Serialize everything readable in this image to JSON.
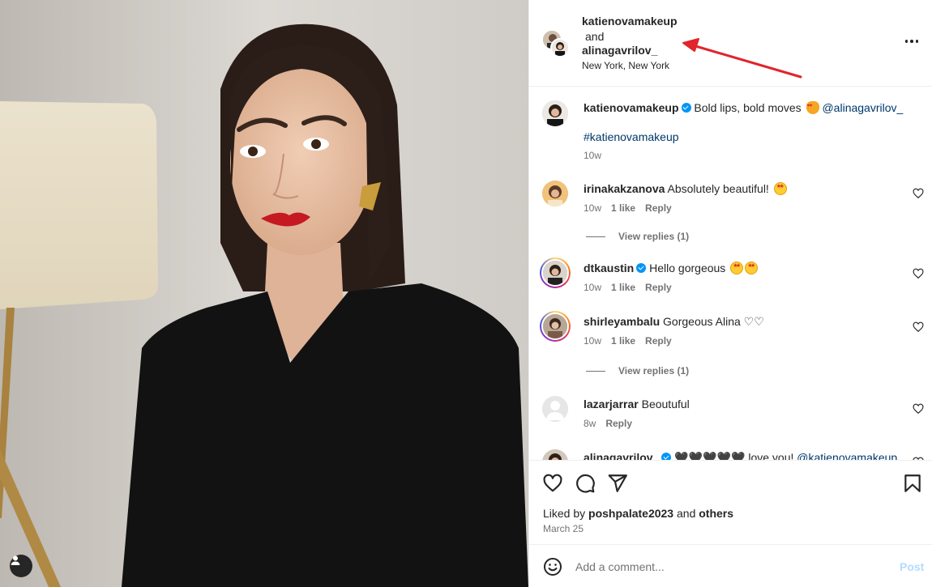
{
  "post": {
    "tag_icon": "user-tag-icon"
  },
  "header": {
    "user1": "katienovamakeup",
    "and_text": "and",
    "user2": "alinagavrilov_",
    "location": "New York, New York",
    "more_icon": "more-horizontal-icon"
  },
  "caption": {
    "username": "katienovamakeup",
    "text": "Bold lips, bold moves",
    "mention": "@alinagavrilov_",
    "hashtag": "#katienovamakeup",
    "time": "10w"
  },
  "comments": [
    {
      "username": "irinakakzanova",
      "text": "Absolutely beautiful!",
      "time": "10w",
      "likes": "1 like",
      "reply": "Reply",
      "view_replies": "View replies (1)"
    },
    {
      "username": "dtkaustin",
      "text": "Hello gorgeous",
      "time": "10w",
      "likes": "1 like",
      "reply": "Reply"
    },
    {
      "username": "shirleyambalu",
      "text": "Gorgeous Alina ♡♡",
      "time": "10w",
      "likes": "1 like",
      "reply": "Reply",
      "view_replies": "View replies (1)"
    },
    {
      "username": "lazarjarrar",
      "text": "Beoutuful",
      "time": "8w",
      "reply": "Reply"
    },
    {
      "username": "alinagavrilov_",
      "text": "🖤🖤🖤🖤🖤 love you!",
      "mention": "@katienovamakeup"
    }
  ],
  "actions": {
    "like_icon": "heart-icon",
    "comment_icon": "comment-icon",
    "share_icon": "send-icon",
    "save_icon": "bookmark-icon",
    "liked_prefix": "Liked by",
    "liked_user": "poshpalate2023",
    "liked_and": "and",
    "liked_others": "others",
    "date": "March 25"
  },
  "add_comment": {
    "emoji_icon": "smiley-icon",
    "placeholder": "Add a comment...",
    "post_label": "Post"
  },
  "colors": {
    "link": "#00376b",
    "verified": "#0095f6",
    "muted": "#737373",
    "post_disabled": "#b3dbff",
    "annotation_arrow": "#e0252b"
  }
}
